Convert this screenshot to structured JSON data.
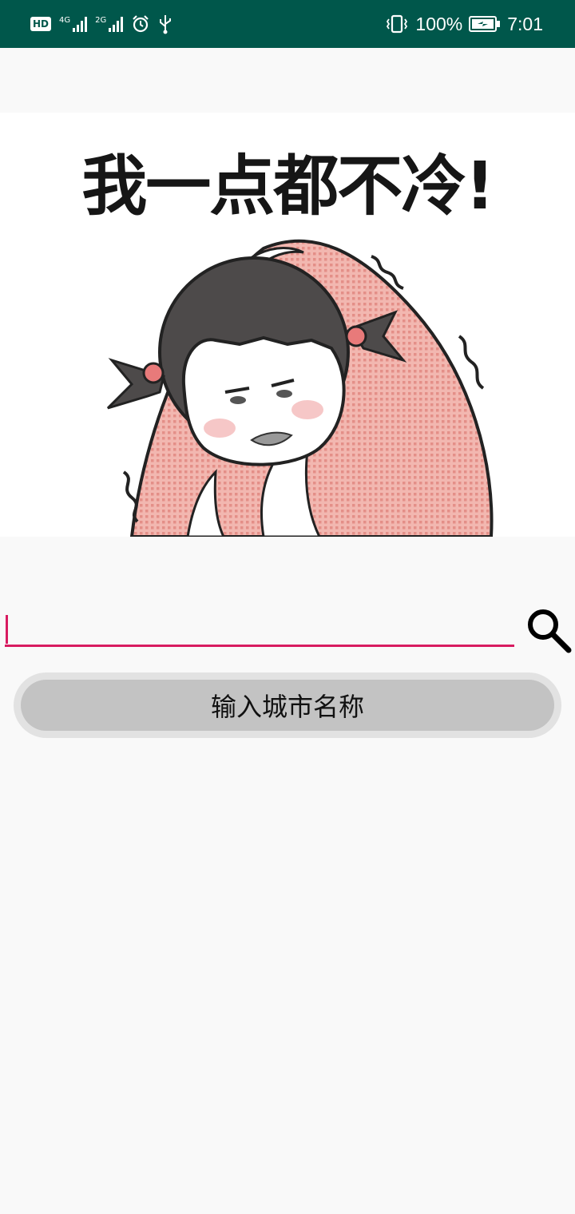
{
  "status_bar": {
    "hd_label": "HD",
    "network1_label": "4G",
    "network2_label": "2G",
    "alarm_icon": "alarm-clock-icon",
    "usb_icon": "usb-icon",
    "vibrate_icon": "vibrate-icon",
    "battery_percent": "100%",
    "battery_level": 1.0,
    "time": "7:01",
    "background_color": "#00574b"
  },
  "banner": {
    "caption": "我一点都不冷!",
    "illustration": "girl-wrapped-in-blanket-shivering"
  },
  "search": {
    "input_value": "",
    "input_placeholder": "",
    "underline_color": "#d81b60",
    "search_icon": "search-icon"
  },
  "city_button": {
    "label": "输入城市名称"
  }
}
